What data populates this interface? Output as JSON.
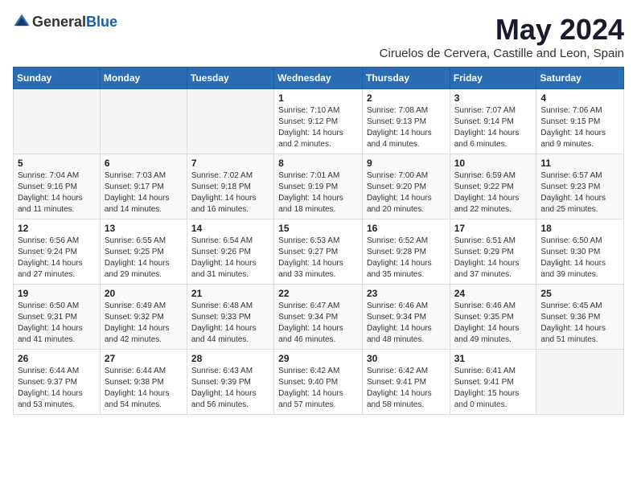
{
  "logo": {
    "general": "General",
    "blue": "Blue"
  },
  "header": {
    "month_year": "May 2024",
    "location": "Ciruelos de Cervera, Castille and Leon, Spain"
  },
  "weekdays": [
    "Sunday",
    "Monday",
    "Tuesday",
    "Wednesday",
    "Thursday",
    "Friday",
    "Saturday"
  ],
  "weeks": [
    [
      {
        "day": "",
        "sunrise": "",
        "sunset": "",
        "daylight": ""
      },
      {
        "day": "",
        "sunrise": "",
        "sunset": "",
        "daylight": ""
      },
      {
        "day": "",
        "sunrise": "",
        "sunset": "",
        "daylight": ""
      },
      {
        "day": "1",
        "sunrise": "Sunrise: 7:10 AM",
        "sunset": "Sunset: 9:12 PM",
        "daylight": "Daylight: 14 hours and 2 minutes."
      },
      {
        "day": "2",
        "sunrise": "Sunrise: 7:08 AM",
        "sunset": "Sunset: 9:13 PM",
        "daylight": "Daylight: 14 hours and 4 minutes."
      },
      {
        "day": "3",
        "sunrise": "Sunrise: 7:07 AM",
        "sunset": "Sunset: 9:14 PM",
        "daylight": "Daylight: 14 hours and 6 minutes."
      },
      {
        "day": "4",
        "sunrise": "Sunrise: 7:06 AM",
        "sunset": "Sunset: 9:15 PM",
        "daylight": "Daylight: 14 hours and 9 minutes."
      }
    ],
    [
      {
        "day": "5",
        "sunrise": "Sunrise: 7:04 AM",
        "sunset": "Sunset: 9:16 PM",
        "daylight": "Daylight: 14 hours and 11 minutes."
      },
      {
        "day": "6",
        "sunrise": "Sunrise: 7:03 AM",
        "sunset": "Sunset: 9:17 PM",
        "daylight": "Daylight: 14 hours and 14 minutes."
      },
      {
        "day": "7",
        "sunrise": "Sunrise: 7:02 AM",
        "sunset": "Sunset: 9:18 PM",
        "daylight": "Daylight: 14 hours and 16 minutes."
      },
      {
        "day": "8",
        "sunrise": "Sunrise: 7:01 AM",
        "sunset": "Sunset: 9:19 PM",
        "daylight": "Daylight: 14 hours and 18 minutes."
      },
      {
        "day": "9",
        "sunrise": "Sunrise: 7:00 AM",
        "sunset": "Sunset: 9:20 PM",
        "daylight": "Daylight: 14 hours and 20 minutes."
      },
      {
        "day": "10",
        "sunrise": "Sunrise: 6:59 AM",
        "sunset": "Sunset: 9:22 PM",
        "daylight": "Daylight: 14 hours and 22 minutes."
      },
      {
        "day": "11",
        "sunrise": "Sunrise: 6:57 AM",
        "sunset": "Sunset: 9:23 PM",
        "daylight": "Daylight: 14 hours and 25 minutes."
      }
    ],
    [
      {
        "day": "12",
        "sunrise": "Sunrise: 6:56 AM",
        "sunset": "Sunset: 9:24 PM",
        "daylight": "Daylight: 14 hours and 27 minutes."
      },
      {
        "day": "13",
        "sunrise": "Sunrise: 6:55 AM",
        "sunset": "Sunset: 9:25 PM",
        "daylight": "Daylight: 14 hours and 29 minutes."
      },
      {
        "day": "14",
        "sunrise": "Sunrise: 6:54 AM",
        "sunset": "Sunset: 9:26 PM",
        "daylight": "Daylight: 14 hours and 31 minutes."
      },
      {
        "day": "15",
        "sunrise": "Sunrise: 6:53 AM",
        "sunset": "Sunset: 9:27 PM",
        "daylight": "Daylight: 14 hours and 33 minutes."
      },
      {
        "day": "16",
        "sunrise": "Sunrise: 6:52 AM",
        "sunset": "Sunset: 9:28 PM",
        "daylight": "Daylight: 14 hours and 35 minutes."
      },
      {
        "day": "17",
        "sunrise": "Sunrise: 6:51 AM",
        "sunset": "Sunset: 9:29 PM",
        "daylight": "Daylight: 14 hours and 37 minutes."
      },
      {
        "day": "18",
        "sunrise": "Sunrise: 6:50 AM",
        "sunset": "Sunset: 9:30 PM",
        "daylight": "Daylight: 14 hours and 39 minutes."
      }
    ],
    [
      {
        "day": "19",
        "sunrise": "Sunrise: 6:50 AM",
        "sunset": "Sunset: 9:31 PM",
        "daylight": "Daylight: 14 hours and 41 minutes."
      },
      {
        "day": "20",
        "sunrise": "Sunrise: 6:49 AM",
        "sunset": "Sunset: 9:32 PM",
        "daylight": "Daylight: 14 hours and 42 minutes."
      },
      {
        "day": "21",
        "sunrise": "Sunrise: 6:48 AM",
        "sunset": "Sunset: 9:33 PM",
        "daylight": "Daylight: 14 hours and 44 minutes."
      },
      {
        "day": "22",
        "sunrise": "Sunrise: 6:47 AM",
        "sunset": "Sunset: 9:34 PM",
        "daylight": "Daylight: 14 hours and 46 minutes."
      },
      {
        "day": "23",
        "sunrise": "Sunrise: 6:46 AM",
        "sunset": "Sunset: 9:34 PM",
        "daylight": "Daylight: 14 hours and 48 minutes."
      },
      {
        "day": "24",
        "sunrise": "Sunrise: 6:46 AM",
        "sunset": "Sunset: 9:35 PM",
        "daylight": "Daylight: 14 hours and 49 minutes."
      },
      {
        "day": "25",
        "sunrise": "Sunrise: 6:45 AM",
        "sunset": "Sunset: 9:36 PM",
        "daylight": "Daylight: 14 hours and 51 minutes."
      }
    ],
    [
      {
        "day": "26",
        "sunrise": "Sunrise: 6:44 AM",
        "sunset": "Sunset: 9:37 PM",
        "daylight": "Daylight: 14 hours and 53 minutes."
      },
      {
        "day": "27",
        "sunrise": "Sunrise: 6:44 AM",
        "sunset": "Sunset: 9:38 PM",
        "daylight": "Daylight: 14 hours and 54 minutes."
      },
      {
        "day": "28",
        "sunrise": "Sunrise: 6:43 AM",
        "sunset": "Sunset: 9:39 PM",
        "daylight": "Daylight: 14 hours and 56 minutes."
      },
      {
        "day": "29",
        "sunrise": "Sunrise: 6:42 AM",
        "sunset": "Sunset: 9:40 PM",
        "daylight": "Daylight: 14 hours and 57 minutes."
      },
      {
        "day": "30",
        "sunrise": "Sunrise: 6:42 AM",
        "sunset": "Sunset: 9:41 PM",
        "daylight": "Daylight: 14 hours and 58 minutes."
      },
      {
        "day": "31",
        "sunrise": "Sunrise: 6:41 AM",
        "sunset": "Sunset: 9:41 PM",
        "daylight": "Daylight: 15 hours and 0 minutes."
      },
      {
        "day": "",
        "sunrise": "",
        "sunset": "",
        "daylight": ""
      }
    ]
  ]
}
